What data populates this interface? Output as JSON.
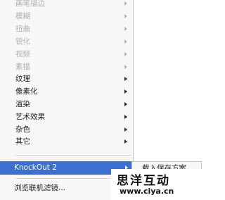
{
  "menu": {
    "items": [
      {
        "label": "画笔描边",
        "disabled": true,
        "submenu": true
      },
      {
        "label": "模糊",
        "disabled": true,
        "submenu": true
      },
      {
        "label": "扭曲",
        "disabled": true,
        "submenu": true
      },
      {
        "label": "锐化",
        "disabled": true,
        "submenu": true
      },
      {
        "label": "视频",
        "disabled": true,
        "submenu": true
      },
      {
        "label": "素描",
        "disabled": true,
        "submenu": true
      },
      {
        "label": "纹理",
        "disabled": false,
        "submenu": true
      },
      {
        "label": "像素化",
        "disabled": false,
        "submenu": true
      },
      {
        "label": "渲染",
        "disabled": false,
        "submenu": true
      },
      {
        "label": "艺术效果",
        "disabled": false,
        "submenu": true
      },
      {
        "label": "杂色",
        "disabled": false,
        "submenu": true
      },
      {
        "label": "其它",
        "disabled": false,
        "submenu": true
      }
    ],
    "plugin_item": {
      "label": "KnockOut 2",
      "submenu": true
    },
    "browse_item": {
      "label": "浏览联机滤镜..."
    }
  },
  "submenu": {
    "items": [
      {
        "label": "载入保存方案"
      }
    ]
  },
  "watermark": {
    "name": "思洋互动",
    "url": "www.ciya.cn"
  },
  "colors": {
    "menu_bg": "#f7f7f7",
    "highlight": "#3b6fd0",
    "disabled_text": "#b0b0b0",
    "text": "#222222"
  }
}
